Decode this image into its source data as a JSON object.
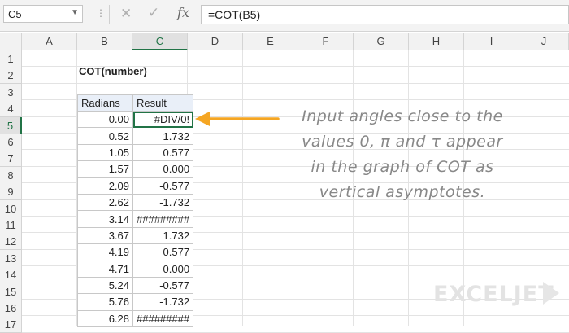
{
  "namebox": "C5",
  "formula_bar": {
    "fx_label": "fx",
    "formula": "=COT(B5)"
  },
  "columns": [
    "A",
    "B",
    "C",
    "D",
    "E",
    "F",
    "G",
    "H",
    "I",
    "J"
  ],
  "rows": [
    "1",
    "2",
    "3",
    "4",
    "5",
    "6",
    "7",
    "8",
    "9",
    "10",
    "11",
    "12",
    "13",
    "14",
    "15",
    "16",
    "17"
  ],
  "title": "COT(number)",
  "table": {
    "headers": [
      "Radians",
      "Result"
    ],
    "rows": [
      [
        "0.00",
        "#DIV/0!"
      ],
      [
        "0.52",
        "1.732"
      ],
      [
        "1.05",
        "0.577"
      ],
      [
        "1.57",
        "0.000"
      ],
      [
        "2.09",
        "-0.577"
      ],
      [
        "2.62",
        "-1.732"
      ],
      [
        "3.14",
        "#########"
      ],
      [
        "3.67",
        "1.732"
      ],
      [
        "4.19",
        "0.577"
      ],
      [
        "4.71",
        "0.000"
      ],
      [
        "5.24",
        "-0.577"
      ],
      [
        "5.76",
        "-1.732"
      ],
      [
        "6.28",
        "#########"
      ]
    ]
  },
  "callout": {
    "line1": "Input angles close to the",
    "line2": "values 0, π and τ appear",
    "line3": "in the graph of COT as",
    "line4": "vertical asymptotes."
  },
  "logo": "EXCELJET",
  "colors": {
    "arrow": "#f5a623",
    "active_cell": "#217346",
    "header_fill": "#e9eff8"
  }
}
